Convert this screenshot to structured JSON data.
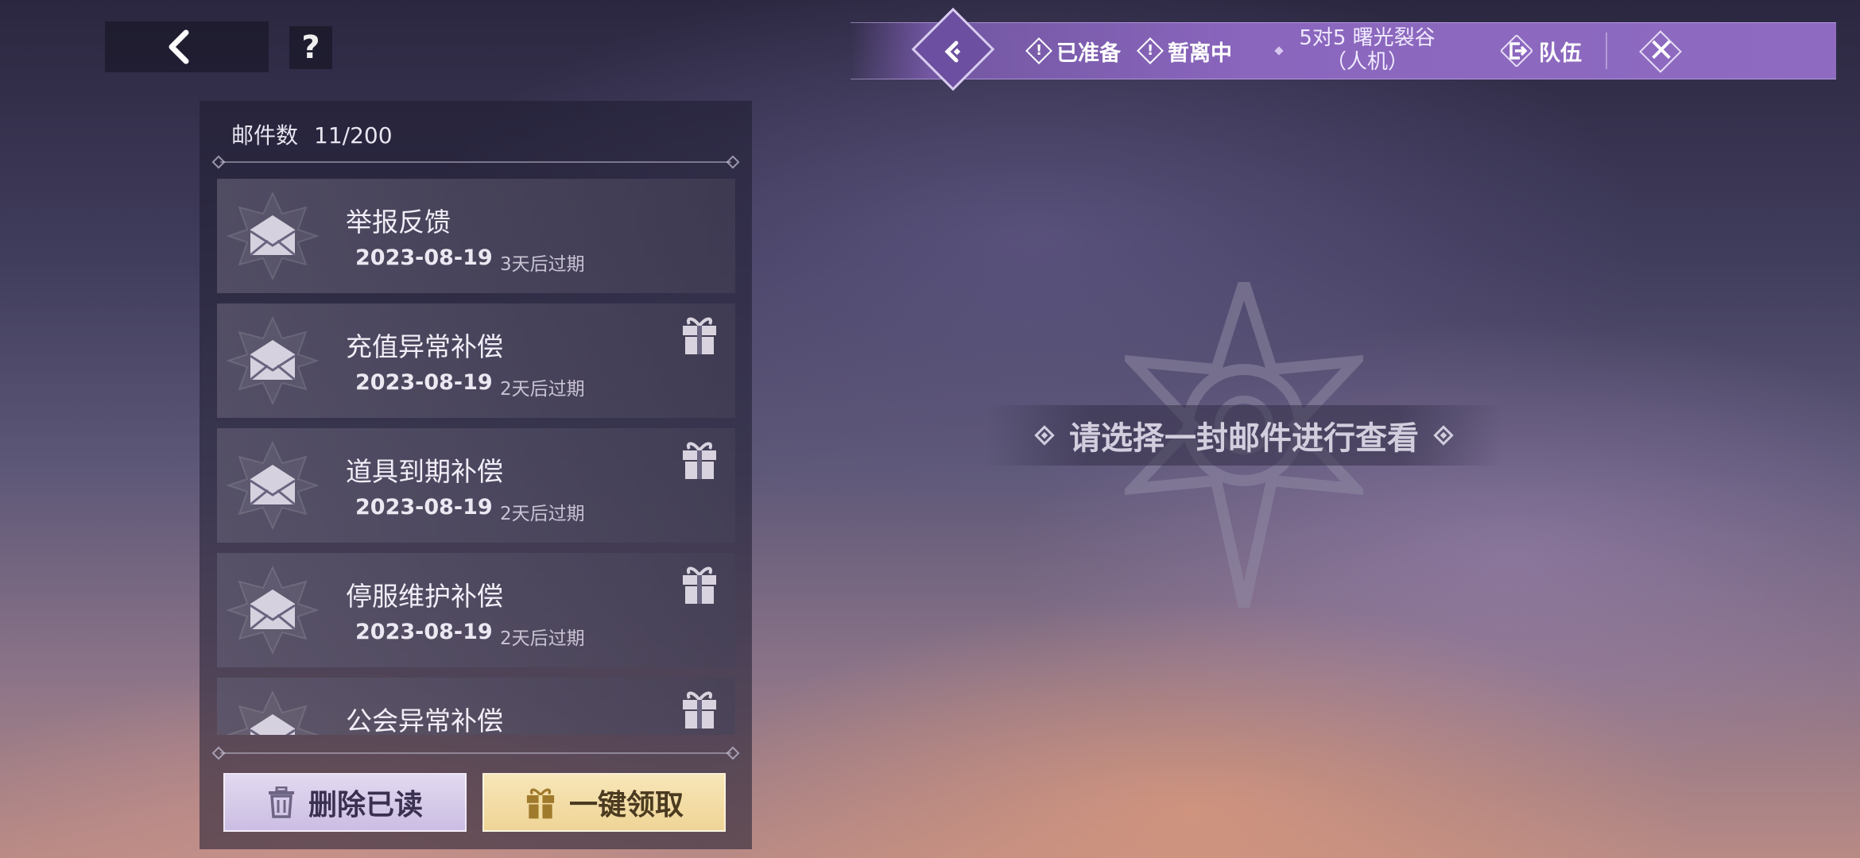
{
  "topbar": {
    "back_icon": "chevron-left-icon",
    "help_label": "?"
  },
  "status_bar": {
    "ready_label": "已准备",
    "away_label": "暂离中",
    "mode_line1": "5对5 曙光裂谷",
    "mode_line2": "（人机）",
    "team_label": "队伍",
    "accent_color": "#8a66bd"
  },
  "mailbox": {
    "count_label": "邮件数",
    "count_value": "11/200",
    "items": [
      {
        "subject": "举报反馈",
        "date": "2023-08-19",
        "expire": "3天后过期",
        "has_gift": false
      },
      {
        "subject": "充值异常补偿",
        "date": "2023-08-19",
        "expire": "2天后过期",
        "has_gift": true
      },
      {
        "subject": "道具到期补偿",
        "date": "2023-08-19",
        "expire": "2天后过期",
        "has_gift": true
      },
      {
        "subject": "停服维护补偿",
        "date": "2023-08-19",
        "expire": "2天后过期",
        "has_gift": true
      },
      {
        "subject": "公会异常补偿",
        "date": "",
        "expire": "",
        "has_gift": true
      }
    ],
    "delete_read_label": "删除已读",
    "claim_all_label": "一键领取"
  },
  "detail": {
    "prompt": "请选择一封邮件进行查看"
  }
}
